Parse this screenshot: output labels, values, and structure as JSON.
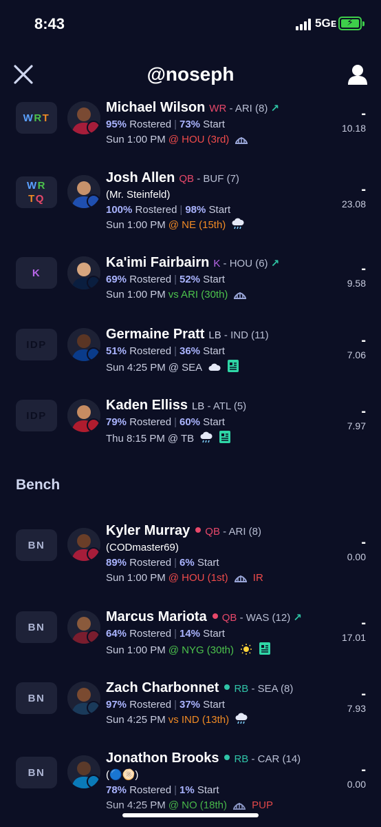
{
  "status": {
    "time": "8:43",
    "network": "5Gᴇ"
  },
  "header": {
    "title": "@noseph"
  },
  "colors": {
    "rostered": "#aab4ff",
    "start": "#aab4ff",
    "trend_up": "#2ec4a4",
    "pos_red": "#e8486a",
    "pos_purple": "#b866e8",
    "pos_teal": "#30c4a8",
    "opp_bad": "#ef4b4b",
    "opp_mid": "#f08a24",
    "opp_good": "#4cc24c"
  },
  "starters": [
    {
      "slot": "WRT",
      "name": "Michael Wilson",
      "pos": "WR",
      "team": "ARI (8)",
      "trend": "↗",
      "rostered": "95%",
      "start": "73%",
      "time": "Sun 1:00 PM",
      "opp": "@ HOU (3rd)",
      "opp_tone": "bad",
      "score_dash": "-",
      "points": "10.18",
      "icons": [
        "dome-icon"
      ]
    },
    {
      "slot": "WRTQ",
      "name": "Josh Allen",
      "pos": "QB",
      "team": "BUF (7)",
      "nickname": "(Mr. Steinfeld)",
      "rostered": "100%",
      "start": "98%",
      "time": "Sun 1:00 PM",
      "opp": "@ NE (15th)",
      "opp_tone": "mid",
      "score_dash": "-",
      "points": "23.08",
      "icons": [
        "cloud-rain-icon"
      ]
    },
    {
      "slot": "K",
      "name": "Ka'imi Fairbairn",
      "pos": "K",
      "team": "HOU (6)",
      "trend": "↗",
      "rostered": "69%",
      "start": "52%",
      "time": "Sun 1:00 PM",
      "opp": "vs ARI (30th)",
      "opp_tone": "good",
      "score_dash": "-",
      "points": "9.58",
      "icons": [
        "dome-icon"
      ]
    },
    {
      "slot": "IDP",
      "name": "Germaine Pratt",
      "pos": "LB",
      "team": "IND (11)",
      "rostered": "51%",
      "start": "36%",
      "time": "Sun 4:25 PM",
      "opp": "@ SEA",
      "opp_tone": "neutral",
      "score_dash": "-",
      "points": "7.06",
      "icons": [
        "cloud-icon",
        "news-icon"
      ]
    },
    {
      "slot": "IDP",
      "name": "Kaden Elliss",
      "pos": "LB",
      "team": "ATL (5)",
      "rostered": "79%",
      "start": "60%",
      "time": "Thu 8:15 PM",
      "opp": "@ TB",
      "opp_tone": "neutral",
      "score_dash": "-",
      "points": "7.97",
      "icons": [
        "cloud-rain-icon",
        "news-icon"
      ]
    }
  ],
  "bench": {
    "label": "Bench",
    "players": [
      {
        "slot": "BN",
        "name": "Kyler Murray",
        "pos": "QB",
        "pos_dot": "#e8486a",
        "team": "ARI (8)",
        "nickname": "(CODmaster69)",
        "rostered": "89%",
        "start": "6%",
        "time": "Sun 1:00 PM",
        "opp": "@ HOU (1st)",
        "opp_tone": "bad",
        "tag": "IR",
        "score_dash": "-",
        "points": "0.00",
        "icons": [
          "dome-icon"
        ]
      },
      {
        "slot": "BN",
        "name": "Marcus Mariota",
        "pos": "QB",
        "pos_dot": "#e8486a",
        "team": "WAS (12)",
        "trend": "↗",
        "rostered": "64%",
        "start": "14%",
        "time": "Sun 1:00 PM",
        "opp": "@ NYG (30th)",
        "opp_tone": "good",
        "score_dash": "-",
        "points": "17.01",
        "icons": [
          "sun-icon",
          "news-icon"
        ]
      },
      {
        "slot": "BN",
        "name": "Zach Charbonnet",
        "pos": "RB",
        "pos_dot": "#30c4a8",
        "team": "SEA (8)",
        "rostered": "97%",
        "start": "37%",
        "time": "Sun 4:25 PM",
        "opp": "vs IND (13th)",
        "opp_tone": "mid",
        "score_dash": "-",
        "points": "7.93",
        "icons": [
          "cloud-rain-icon"
        ]
      },
      {
        "slot": "BN",
        "name": "Jonathon Brooks",
        "pos": "RB",
        "pos_dot": "#30c4a8",
        "team": "CAR (14)",
        "nickname": "(🔵🫓)",
        "rostered": "78%",
        "start": "1%",
        "time": "Sun 4:25 PM",
        "opp": "@ NO (18th)",
        "opp_tone": "good",
        "tag": "PUP",
        "score_dash": "-",
        "points": "0.00",
        "icons": [
          "dome-icon"
        ]
      }
    ]
  }
}
